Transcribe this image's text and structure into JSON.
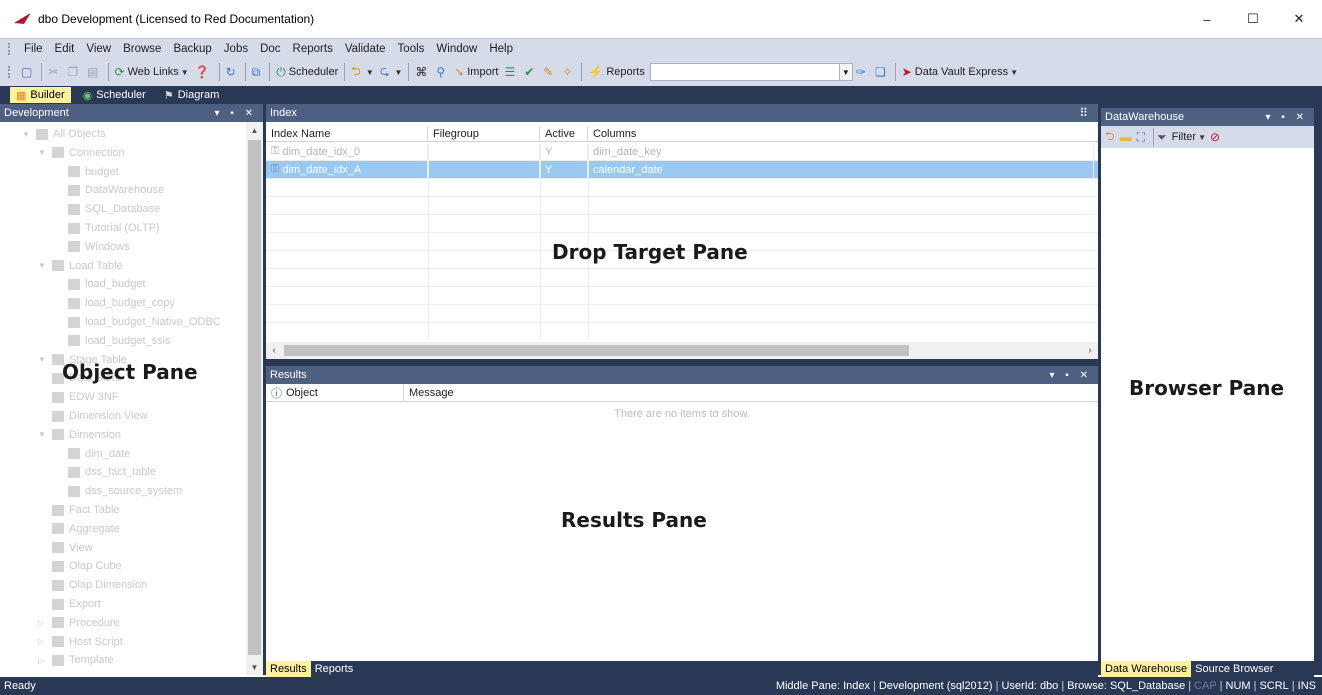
{
  "window": {
    "title": "dbo Development (Licensed to Red Documentation)",
    "controls": [
      "–",
      "☐",
      "✕"
    ]
  },
  "menu": [
    "File",
    "Edit",
    "View",
    "Browse",
    "Backup",
    "Jobs",
    "Doc",
    "Reports",
    "Validate",
    "Tools",
    "Window",
    "Help"
  ],
  "toolbar": {
    "web_links": "Web Links",
    "scheduler": "Scheduler",
    "import": "Import",
    "reports": "Reports",
    "reports_value": "",
    "data_vault": "Data Vault Express"
  },
  "tabs": {
    "builder": "Builder",
    "scheduler": "Scheduler",
    "diagram": "Diagram"
  },
  "object_pane": {
    "header": "Development",
    "label": "Object Pane",
    "tree": [
      "All Objects",
      "Connection",
      "budget",
      "DataWarehouse",
      "SQL_Database",
      "Tutorial (OLTP)",
      "Windows",
      "Load Table",
      "load_budget",
      "load_budget_copy",
      "load_budget_Native_ODBC",
      "load_budget_ssis",
      "Stage Table",
      "Data Store",
      "EDW 3NF",
      "Dimension View",
      "Dimension",
      "dim_date",
      "dss_fact_table",
      "dss_source_system",
      "Fact Table",
      "Aggregate",
      "View",
      "Olap Cube",
      "Olap Dimension",
      "Export",
      "Procedure",
      "Host Script",
      "Template"
    ]
  },
  "index_pane": {
    "header": "Index",
    "label": "Drop Target Pane",
    "columns": [
      "Index Name",
      "Filegroup",
      "Active",
      "Columns"
    ],
    "rows": [
      {
        "name": "dim_date_idx_0",
        "filegroup": "",
        "active": "Y",
        "columns": "dim_date_key"
      },
      {
        "name": "dim_date_idx_A",
        "filegroup": "",
        "active": "Y",
        "columns": "calendar_date"
      }
    ]
  },
  "results_pane": {
    "header": "Results",
    "label": "Results Pane",
    "columns": [
      "Object",
      "Message"
    ],
    "empty_text": "There are no items to show.",
    "tabs": [
      "Results",
      "Reports"
    ]
  },
  "browser_pane": {
    "header": "DataWarehouse",
    "label": "Browser Pane",
    "filter": "Filter",
    "tabs": [
      "Data Warehouse",
      "Source Browser"
    ]
  },
  "status": {
    "left": "Ready",
    "middle_pane": "Middle Pane: Index",
    "connection": "Development (sql2012)",
    "user": "UserId: dbo",
    "browse": "Browse: SQL_Database",
    "cap": "CAP",
    "num": "NUM",
    "scrl": "SCRL",
    "ins": "INS"
  },
  "colors": {
    "chrome": "#d6dbe9",
    "dark": "#293955",
    "pane_header": "#4d6082",
    "active_tab": "#fff29d",
    "selection": "#99c8f0"
  }
}
